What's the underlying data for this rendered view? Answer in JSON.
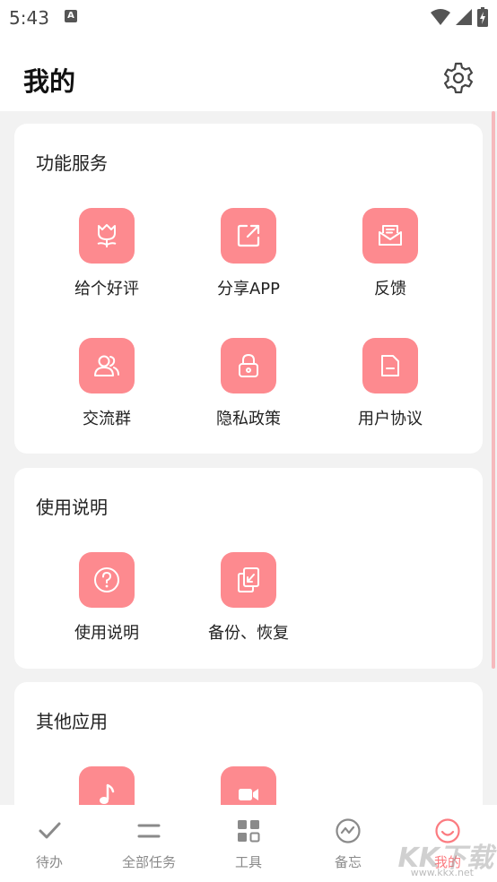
{
  "status_bar": {
    "time": "5:43",
    "notification_glyph": "A"
  },
  "header": {
    "title": "我的"
  },
  "sections": {
    "services": {
      "title": "功能服务",
      "items": [
        {
          "label": "给个好评",
          "icon": "tulip-icon"
        },
        {
          "label": "分享APP",
          "icon": "share-icon"
        },
        {
          "label": "反馈",
          "icon": "envelope-icon"
        },
        {
          "label": "交流群",
          "icon": "group-icon"
        },
        {
          "label": "隐私政策",
          "icon": "lock-icon"
        },
        {
          "label": "用户协议",
          "icon": "document-icon"
        }
      ]
    },
    "instructions": {
      "title": "使用说明",
      "items": [
        {
          "label": "使用说明",
          "icon": "question-icon"
        },
        {
          "label": "备份、恢复",
          "icon": "backup-icon"
        }
      ]
    },
    "other_apps": {
      "title": "其他应用",
      "items": [
        {
          "icon": "music-note-icon"
        },
        {
          "icon": "video-camera-icon"
        }
      ]
    }
  },
  "bottom_nav": [
    {
      "label": "待办",
      "icon": "check-icon",
      "active": false
    },
    {
      "label": "全部任务",
      "icon": "list-icon",
      "active": false
    },
    {
      "label": "工具",
      "icon": "grid-icon",
      "active": false
    },
    {
      "label": "备忘",
      "icon": "chat-wave-icon",
      "active": false
    },
    {
      "label": "我的",
      "icon": "profile-smile-icon",
      "active": true
    }
  ],
  "watermark": {
    "text": "KK下载",
    "url": "www.kkx.net"
  },
  "colors": {
    "accent": "#fd8a8f",
    "active_nav": "#fb7b80",
    "background": "#f2f2f2"
  }
}
